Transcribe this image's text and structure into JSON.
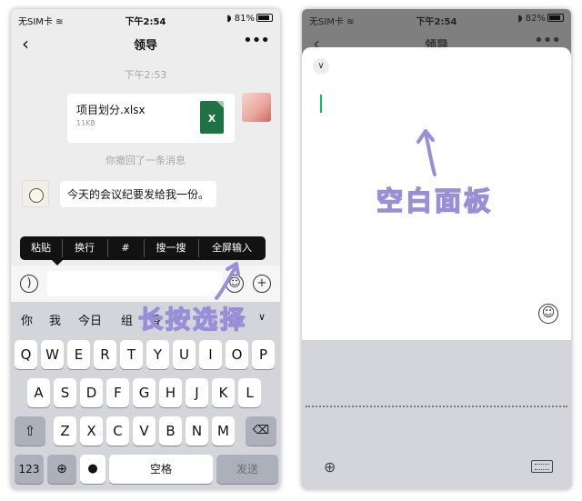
{
  "status_bar": {
    "carrier": "无SIM卡",
    "time": "下午2:54",
    "battery": "81%",
    "battery_right": "82%"
  },
  "chat": {
    "title": "领导",
    "timestamp": "下午2:53",
    "file": {
      "name": "项目划分.xlsx",
      "size": "11KB",
      "icon": "excel-icon"
    },
    "recall_notice": "你撤回了一条消息",
    "message": "今天的会议纪要发给我一份。"
  },
  "context_menu": {
    "items": [
      "粘贴",
      "换行",
      "#",
      "搜一搜",
      "全屏输入"
    ]
  },
  "keyboard": {
    "candidates": [
      "你",
      "我",
      "今日",
      "组",
      "香",
      "捂"
    ],
    "row1": [
      "Q",
      "W",
      "E",
      "R",
      "T",
      "Y",
      "U",
      "I",
      "O",
      "P"
    ],
    "row2": [
      "A",
      "S",
      "D",
      "F",
      "G",
      "H",
      "J",
      "K",
      "L"
    ],
    "row3": [
      "Z",
      "X",
      "C",
      "V",
      "B",
      "N",
      "M"
    ],
    "num_label": "123",
    "space_label": "空格",
    "send_label": "发送"
  },
  "annotations": {
    "left": "长按选择",
    "right": "空白面板"
  },
  "colors": {
    "accent": "#07c160",
    "annotation": "#9b8ed8",
    "excel": "#1f7244"
  }
}
